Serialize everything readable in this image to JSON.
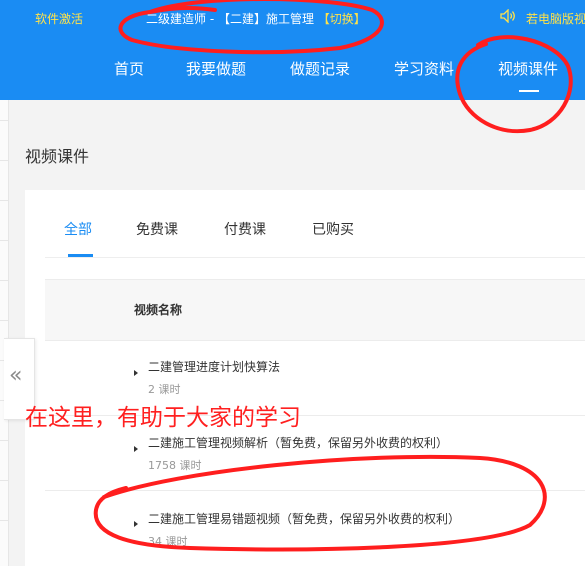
{
  "header": {
    "activate_label": "软件激活",
    "exam_title_prefix": "二级建造师 - 【二建】施工管理 ",
    "switch_label": "【切换】",
    "pc_tip": "若电脑版视",
    "nav": [
      "首页",
      "我要做题",
      "做题记录",
      "学习资料",
      "视频课件"
    ],
    "active_nav": "视频课件"
  },
  "page": {
    "title": "视频课件"
  },
  "tabs": {
    "items": [
      "全部",
      "免费课",
      "付费课",
      "已购买"
    ],
    "active": "全部"
  },
  "table": {
    "column_name": "视频名称",
    "rows": [
      {
        "title": "二建管理进度计划快算法",
        "count": "2 课时"
      },
      {
        "title": "二建施工管理视频解析（暂免费，保留另外收费的权利）",
        "count": "1758 课时"
      },
      {
        "title": "二建施工管理易错题视频（暂免费，保留另外收费的权利）",
        "count": "34 课时"
      }
    ]
  },
  "sidebar_toggle": {
    "icon": "double-chevron-left-icon",
    "glyph": "«"
  },
  "annotation": {
    "text": "在这里，有助于大家的学习",
    "color": "#ff2020"
  },
  "colors": {
    "brand": "#1a8cf3",
    "highlight": "#ffe24a",
    "annotation": "#ff2020"
  }
}
